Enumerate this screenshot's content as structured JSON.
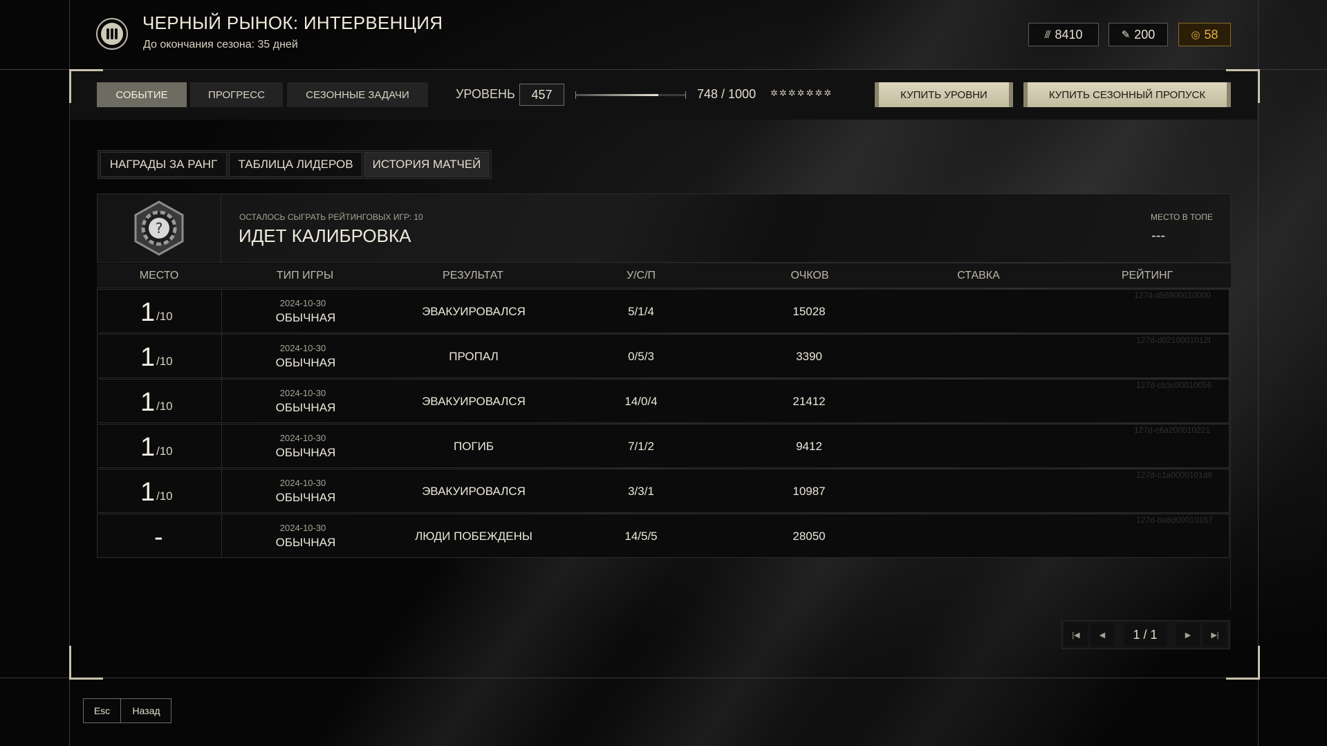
{
  "header": {
    "title": "ЧЕРНЫЙ РЫНОК: ИНТЕРВЕНЦИЯ",
    "subtitle": "До окончания сезона: 35 дней",
    "currencies": [
      {
        "icon": "credits-icon",
        "value": "8410"
      },
      {
        "icon": "feather-icon",
        "value": "200"
      },
      {
        "icon": "gold-coin-icon",
        "value": "58",
        "color": "#e8b246"
      }
    ]
  },
  "topbar": {
    "tabs": [
      {
        "label": "СОБЫТИЕ",
        "active": true
      },
      {
        "label": "ПРОГРЕСС",
        "active": false
      },
      {
        "label": "СЕЗОННЫЕ ЗАДАЧИ",
        "active": false
      }
    ],
    "level_label": "УРОВЕНЬ",
    "level_value": "457",
    "xp_current": 748,
    "xp_max": 1000,
    "xp_text": "748 / 1000",
    "xp_stars": "✲✲✲✲✲✲✲",
    "buy_levels_label": "КУПИТЬ УРОВНИ",
    "buy_pass_label": "КУПИТЬ СЕЗОННЫЙ ПРОПУСК"
  },
  "subtabs": [
    {
      "label": "НАГРАДЫ ЗА РАНГ",
      "active": false
    },
    {
      "label": "ТАБЛИЦА ЛИДЕРОВ",
      "active": false
    },
    {
      "label": "ИСТОРИЯ МАТЧЕЙ",
      "active": true
    }
  ],
  "calibration": {
    "hint": "ОСТАЛОСЬ СЫГРАТЬ РЕЙТИНГОВЫХ ИГР: 10",
    "title": "ИДЕТ КАЛИБРОВКА",
    "rank_label": "МЕСТО В ТОПЕ",
    "rank_value": "---",
    "icon": "unknown-rank-icon"
  },
  "table": {
    "headers": [
      "МЕСТО",
      "ТИП ИГРЫ",
      "РЕЗУЛЬТАТ",
      "У/С/П",
      "ОЧКОВ",
      "СТАВКА",
      "РЕЙТИНГ"
    ],
    "rows": [
      {
        "place": "1",
        "place_total": "/10",
        "date": "2024-10-30",
        "type": "ОБЫЧНАЯ",
        "result": "ЭВАКУИРОВАЛСЯ",
        "kda": "5/1/4",
        "score": "15028",
        "id": "127d-d56800010000"
      },
      {
        "place": "1",
        "place_total": "/10",
        "date": "2024-10-30",
        "type": "ОБЫЧНАЯ",
        "result": "ПРОПАЛ",
        "kda": "0/5/3",
        "score": "3390",
        "id": "127d-d0210001012f"
      },
      {
        "place": "1",
        "place_total": "/10",
        "date": "2024-10-30",
        "type": "ОБЫЧНАЯ",
        "result": "ЭВАКУИРОВАЛСЯ",
        "kda": "14/0/4",
        "score": "21412",
        "id": "127d-cb3c00010056"
      },
      {
        "place": "1",
        "place_total": "/10",
        "date": "2024-10-30",
        "type": "ОБЫЧНАЯ",
        "result": "ПОГИБ",
        "kda": "7/1/2",
        "score": "9412",
        "id": "127d-c6a200010221"
      },
      {
        "place": "1",
        "place_total": "/10",
        "date": "2024-10-30",
        "type": "ОБЫЧНАЯ",
        "result": "ЭВАКУИРОВАЛСЯ",
        "kda": "3/3/1",
        "score": "10987",
        "id": "127d-c1a0000101d8"
      },
      {
        "place": "-",
        "place_total": "",
        "date": "2024-10-30",
        "type": "ОБЫЧНАЯ",
        "result": "ЛЮДИ ПОБЕЖДЕНЫ",
        "kda": "14/5/5",
        "score": "28050",
        "id": "127d-ba8d00010167"
      }
    ]
  },
  "pagination": {
    "text": "1 / 1",
    "first_icon": "first-page-icon",
    "prev_icon": "prev-page-icon",
    "next_icon": "next-page-icon",
    "last_icon": "last-page-icon"
  },
  "footer": {
    "key": "Esc",
    "label": "Назад"
  }
}
